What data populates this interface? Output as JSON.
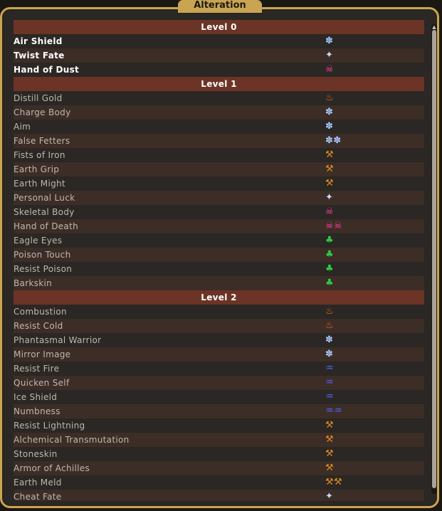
{
  "window": {
    "title": "Alteration"
  },
  "colors": {
    "fire": "#ff6a1a",
    "air": "#a9c9ff",
    "astral": "#cfd7ff",
    "death": "#ff3e9a",
    "nature": "#2ecc40",
    "water": "#5a63ff",
    "earth": "#e08a1e"
  },
  "rows": [
    {
      "type": "header",
      "label": "Level 0"
    },
    {
      "type": "spell",
      "label": "Air Shield",
      "learned": true,
      "icon": "air-icon",
      "paths": 1
    },
    {
      "type": "spell",
      "label": "Twist Fate",
      "learned": true,
      "icon": "astral-icon",
      "paths": 1
    },
    {
      "type": "spell",
      "label": "Hand of Dust",
      "learned": true,
      "icon": "death-icon",
      "paths": 1
    },
    {
      "type": "header",
      "label": "Level 1"
    },
    {
      "type": "spell",
      "label": "Distill Gold",
      "learned": false,
      "icon": "fire-icon",
      "paths": 1
    },
    {
      "type": "spell",
      "label": "Charge Body",
      "learned": false,
      "icon": "air-icon",
      "paths": 1
    },
    {
      "type": "spell",
      "label": "Aim",
      "learned": false,
      "icon": "air-icon",
      "paths": 1
    },
    {
      "type": "spell",
      "label": "False Fetters",
      "learned": false,
      "icon": "air-icon",
      "paths": 2
    },
    {
      "type": "spell",
      "label": "Fists of Iron",
      "learned": false,
      "icon": "earth-icon",
      "paths": 1
    },
    {
      "type": "spell",
      "label": "Earth Grip",
      "learned": false,
      "icon": "earth-icon",
      "paths": 1
    },
    {
      "type": "spell",
      "label": "Earth Might",
      "learned": false,
      "icon": "earth-icon",
      "paths": 1
    },
    {
      "type": "spell",
      "label": "Personal Luck",
      "learned": false,
      "icon": "astral-icon",
      "paths": 1
    },
    {
      "type": "spell",
      "label": "Skeletal Body",
      "learned": false,
      "icon": "death-icon",
      "paths": 1
    },
    {
      "type": "spell",
      "label": "Hand of Death",
      "learned": false,
      "icon": "death-icon",
      "paths": 2
    },
    {
      "type": "spell",
      "label": "Eagle Eyes",
      "learned": false,
      "icon": "nature-icon",
      "paths": 1
    },
    {
      "type": "spell",
      "label": "Poison Touch",
      "learned": false,
      "icon": "nature-icon",
      "paths": 1
    },
    {
      "type": "spell",
      "label": "Resist Poison",
      "learned": false,
      "icon": "nature-icon",
      "paths": 1
    },
    {
      "type": "spell",
      "label": "Barkskin",
      "learned": false,
      "icon": "nature-icon",
      "paths": 1
    },
    {
      "type": "header",
      "label": "Level 2"
    },
    {
      "type": "spell",
      "label": "Combustion",
      "learned": false,
      "icon": "fire-icon",
      "paths": 1
    },
    {
      "type": "spell",
      "label": "Resist Cold",
      "learned": false,
      "icon": "fire-icon",
      "paths": 1
    },
    {
      "type": "spell",
      "label": "Phantasmal Warrior",
      "learned": false,
      "icon": "air-icon",
      "paths": 1
    },
    {
      "type": "spell",
      "label": "Mirror Image",
      "learned": false,
      "icon": "air-icon",
      "paths": 1
    },
    {
      "type": "spell",
      "label": "Resist Fire",
      "learned": false,
      "icon": "water-icon",
      "paths": 1
    },
    {
      "type": "spell",
      "label": "Quicken Self",
      "learned": false,
      "icon": "water-icon",
      "paths": 1
    },
    {
      "type": "spell",
      "label": "Ice Shield",
      "learned": false,
      "icon": "water-icon",
      "paths": 1
    },
    {
      "type": "spell",
      "label": "Numbness",
      "learned": false,
      "icon": "water-icon",
      "paths": 2
    },
    {
      "type": "spell",
      "label": "Resist Lightning",
      "learned": false,
      "icon": "earth-icon",
      "paths": 1
    },
    {
      "type": "spell",
      "label": "Alchemical Transmutation",
      "learned": false,
      "icon": "earth-icon",
      "paths": 1
    },
    {
      "type": "spell",
      "label": "Stoneskin",
      "learned": false,
      "icon": "earth-icon",
      "paths": 1
    },
    {
      "type": "spell",
      "label": "Armor of Achilles",
      "learned": false,
      "icon": "earth-icon",
      "paths": 1
    },
    {
      "type": "spell",
      "label": "Earth Meld",
      "learned": false,
      "icon": "earth-icon",
      "paths": 2
    },
    {
      "type": "spell",
      "label": "Cheat Fate",
      "learned": false,
      "icon": "astral-icon",
      "paths": 1
    }
  ]
}
